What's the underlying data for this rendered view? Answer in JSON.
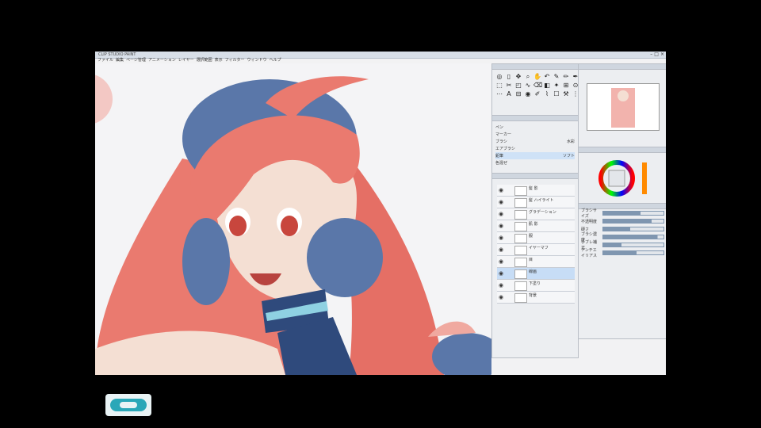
{
  "window": {
    "title": "CLIP STUDIO PAINT",
    "min_icon": "minimize-icon",
    "max_icon": "maximize-icon",
    "close_icon": "close-icon"
  },
  "menu": [
    "ファイル",
    "編集",
    "ページ管理",
    "アニメーション",
    "レイヤー",
    "選択範囲",
    "表示",
    "フィルター",
    "ウィンドウ",
    "ヘルプ"
  ],
  "tools": [
    "◎",
    "▯",
    "✥",
    "⌕",
    "✋",
    "↶",
    "✎",
    "✏",
    "✒",
    "⬚",
    "✂",
    "◰",
    "∿",
    "⌫",
    "◧",
    "✦",
    "⊞",
    "⊙",
    "⋯",
    "A",
    "⊟",
    "◉",
    "✐",
    "⌇",
    "☐",
    "⚒",
    "⋮"
  ],
  "subtools": [
    {
      "label": "ペン",
      "value": "",
      "selected": false
    },
    {
      "label": "マーカー",
      "value": "",
      "selected": false
    },
    {
      "label": "ブラシ",
      "value": "水彩",
      "selected": false
    },
    {
      "label": "エアブラシ",
      "value": "",
      "selected": false
    },
    {
      "label": "鉛筆",
      "value": "ソフト",
      "selected": true
    },
    {
      "label": "色混ぜ",
      "value": "",
      "selected": false
    }
  ],
  "layers": [
    {
      "name": "髪 影",
      "selected": false
    },
    {
      "name": "髪 ハイライト",
      "selected": false
    },
    {
      "name": "グラデーション",
      "selected": false
    },
    {
      "name": "肌 影",
      "selected": false
    },
    {
      "name": "服",
      "selected": false
    },
    {
      "name": "イヤーマフ",
      "selected": false
    },
    {
      "name": "目",
      "selected": false
    },
    {
      "name": "線画",
      "selected": true
    },
    {
      "name": "下塗り",
      "selected": false
    },
    {
      "name": "背景",
      "selected": false
    }
  ],
  "props": [
    {
      "label": "ブラシサイズ",
      "level": 0.62
    },
    {
      "label": "不透明度",
      "level": 0.8
    },
    {
      "label": "硬さ",
      "level": 0.45
    },
    {
      "label": "ブラシ濃度",
      "level": 0.9
    },
    {
      "label": "手ブレ補正",
      "level": 0.3
    },
    {
      "label": "アンチエイリアス",
      "level": 0.55
    }
  ],
  "colors": {
    "hair": "#ea7a6f",
    "hair_dark": "#c85a55",
    "earmuff": "#5a77a9",
    "skin": "#f4dfd3",
    "accent": "#1e6fb0"
  }
}
